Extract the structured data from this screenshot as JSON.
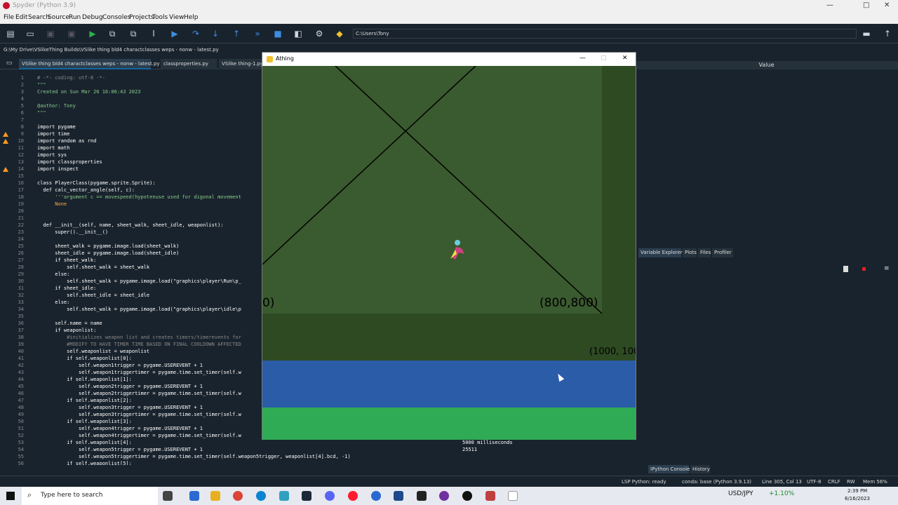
{
  "window": {
    "title": "Spyder (Python 3.9)",
    "min": "—",
    "max": "□",
    "close": "✕"
  },
  "menu": [
    "File",
    "Edit",
    "Search",
    "Source",
    "Run",
    "Debug",
    "Consoles",
    "Projects",
    "Tools",
    "View",
    "Help"
  ],
  "toolbar": {
    "path": "C:\\Users\\Tony"
  },
  "editor": {
    "filepath": "G:\\My Drive\\VSlikeThing Builds\\VSlike thing bld4 charactclasses weps - nonw - latest.py",
    "tabs": [
      "VSlike thing bld4 charactclasses weps - nonw - latest.py",
      "classproperties.py",
      "VSlike thing-1.py"
    ],
    "lines": [
      {
        "n": "1",
        "t": "# -*- coding: utf-8 -*-",
        "c": "#888888"
      },
      {
        "n": "2",
        "t": "\"\"\"",
        "c": "#88cc88"
      },
      {
        "n": "3",
        "t": "Created on Sun Mar 26 16:06:43 2023",
        "c": "#88cc88"
      },
      {
        "n": "4",
        "t": "",
        "c": "#ffffff"
      },
      {
        "n": "5",
        "t": "@author: Tony",
        "c": "#88cc88"
      },
      {
        "n": "6",
        "t": "\"\"\"",
        "c": "#88cc88"
      },
      {
        "n": "7",
        "t": "",
        "c": "#ffffff"
      },
      {
        "n": "8",
        "t": "import pygame",
        "c": "#ffffff"
      },
      {
        "n": "9",
        "t": "import time",
        "c": "#ffffff"
      },
      {
        "n": "10",
        "t": "import random as rnd",
        "c": "#ffffff"
      },
      {
        "n": "11",
        "t": "import math",
        "c": "#ffffff"
      },
      {
        "n": "12",
        "t": "import sys",
        "c": "#ffffff"
      },
      {
        "n": "13",
        "t": "import classproperties",
        "c": "#ffffff"
      },
      {
        "n": "14",
        "t": "import inspect",
        "c": "#ffffff"
      },
      {
        "n": "15",
        "t": "",
        "c": "#ffffff"
      },
      {
        "n": "16",
        "t": "class PlayerClass(pygame.sprite.Sprite):",
        "c": "#ffffff"
      },
      {
        "n": "17",
        "t": "  def calc_vector_angle(self, c):",
        "c": "#ffffff"
      },
      {
        "n": "18",
        "t": "      '''argument c == movespeed(hypotenuse used for digonal movement",
        "c": "#88cc88"
      },
      {
        "n": "19",
        "t": "      None",
        "c": "#ffaa44"
      },
      {
        "n": "20",
        "t": "",
        "c": "#ffffff"
      },
      {
        "n": "21",
        "t": "",
        "c": "#ffffff"
      },
      {
        "n": "22",
        "t": "  def __init__(self, name, sheet_walk, sheet_idle, weaponlist):",
        "c": "#ffffff"
      },
      {
        "n": "23",
        "t": "      super().__init__()",
        "c": "#ffffff"
      },
      {
        "n": "24",
        "t": "",
        "c": "#ffffff"
      },
      {
        "n": "25",
        "t": "      sheet_walk = pygame.image.load(sheet_walk)",
        "c": "#ffffff"
      },
      {
        "n": "26",
        "t": "      sheet_idle = pygame.image.load(sheet_idle)",
        "c": "#ffffff"
      },
      {
        "n": "27",
        "t": "      if sheet_walk:",
        "c": "#ffffff"
      },
      {
        "n": "28",
        "t": "          self.sheet_walk = sheet_walk",
        "c": "#ffffff"
      },
      {
        "n": "29",
        "t": "      else:",
        "c": "#ffffff"
      },
      {
        "n": "30",
        "t": "          self.sheet_walk = pygame.image.load(\"graphics\\player\\Run\\p_",
        "c": "#ffffff"
      },
      {
        "n": "31",
        "t": "      if sheet_idle:",
        "c": "#ffffff"
      },
      {
        "n": "32",
        "t": "          self.sheet_idle = sheet_idle",
        "c": "#ffffff"
      },
      {
        "n": "33",
        "t": "      else:",
        "c": "#ffffff"
      },
      {
        "n": "34",
        "t": "          self.sheet_walk = pygame.image.load(\"graphics\\player\\idle\\p",
        "c": "#ffffff"
      },
      {
        "n": "35",
        "t": "",
        "c": "#ffffff"
      },
      {
        "n": "36",
        "t": "      self.name = name",
        "c": "#ffffff"
      },
      {
        "n": "37",
        "t": "      if weaponlist:",
        "c": "#ffffff"
      },
      {
        "n": "38",
        "t": "          #initializes weapon list and creates timers/timerevents for",
        "c": "#888888"
      },
      {
        "n": "39",
        "t": "          #MODIFY TO HAVE TIMER TIME BASED ON FINAL COOLDOWN AFFECTED",
        "c": "#888888"
      },
      {
        "n": "40",
        "t": "          self.weaponlist = weaponlist",
        "c": "#ffffff"
      },
      {
        "n": "41",
        "t": "          if self.weaponlist[0]:",
        "c": "#ffffff"
      },
      {
        "n": "42",
        "t": "              self.weapon1trigger = pygame.USEREVENT + 1",
        "c": "#ffffff"
      },
      {
        "n": "43",
        "t": "              self.weapon1triggertimer = pygame.time.set_timer(self.w",
        "c": "#ffffff"
      },
      {
        "n": "44",
        "t": "          if self.weaponlist[1]:",
        "c": "#ffffff"
      },
      {
        "n": "45",
        "t": "              self.weapon2trigger = pygame.USEREVENT + 1",
        "c": "#ffffff"
      },
      {
        "n": "46",
        "t": "              self.weapon2triggertimer = pygame.time.set_timer(self.w",
        "c": "#ffffff"
      },
      {
        "n": "47",
        "t": "          if self.weaponlist[2]:",
        "c": "#ffffff"
      },
      {
        "n": "48",
        "t": "              self.weapon3trigger = pygame.USEREVENT + 1",
        "c": "#ffffff"
      },
      {
        "n": "49",
        "t": "              self.weapon3triggertimer = pygame.time.set_timer(self.w",
        "c": "#ffffff"
      },
      {
        "n": "50",
        "t": "          if self.weaponlist[3]:",
        "c": "#ffffff"
      },
      {
        "n": "51",
        "t": "              self.weapon4trigger = pygame.USEREVENT + 1",
        "c": "#ffffff"
      },
      {
        "n": "52",
        "t": "              self.weapon4triggertimer = pygame.time.set_timer(self.w",
        "c": "#ffffff"
      },
      {
        "n": "53",
        "t": "          if self.weaponlist[4]:",
        "c": "#ffffff"
      },
      {
        "n": "54",
        "t": "              self.weapon5trigger = pygame.USEREVENT + 1",
        "c": "#ffffff"
      },
      {
        "n": "55",
        "t": "              self.weapon5triggertimer = pygame.time.set_timer(self.weapon5trigger, weaponlist[4].bcd, -1)",
        "c": "#ffffff"
      },
      {
        "n": "56",
        "t": "          if self.weaponlist[5]:",
        "c": "#ffffff"
      }
    ]
  },
  "variable_explorer": {
    "value_header": "Value",
    "tabs": [
      "Variable Explorer",
      "Plots",
      "Files",
      "Profiler"
    ]
  },
  "console": {
    "lines": [
      "5000 milliseconds",
      "25511"
    ],
    "tabs": [
      "IPython Console",
      "History"
    ]
  },
  "game": {
    "title": "Athing",
    "labels": [
      "0)",
      "(800,800)",
      "(1000, 100"
    ],
    "min": "—",
    "max": "□",
    "close": "✕"
  },
  "status": {
    "lsp": "LSP Python: ready",
    "conda": "conda: base (Python 3.9.13)",
    "pos": "Line 305, Col 13",
    "enc": "UTF-8",
    "eol": "CRLF",
    "rw": "RW",
    "mem": "Mem 56%"
  },
  "taskbar": {
    "search": "Type here to search",
    "ticker": "USD/JPY",
    "ticker_change": "+1.10%",
    "time": "2:39 PM",
    "date": "6/16/2023"
  },
  "colors": {
    "grass_dark": "#3a5a2f",
    "grass_mid": "#2e4a22",
    "water": "#2b5ca8",
    "grass_light": "#2faa55",
    "accent": "#1464a0"
  }
}
